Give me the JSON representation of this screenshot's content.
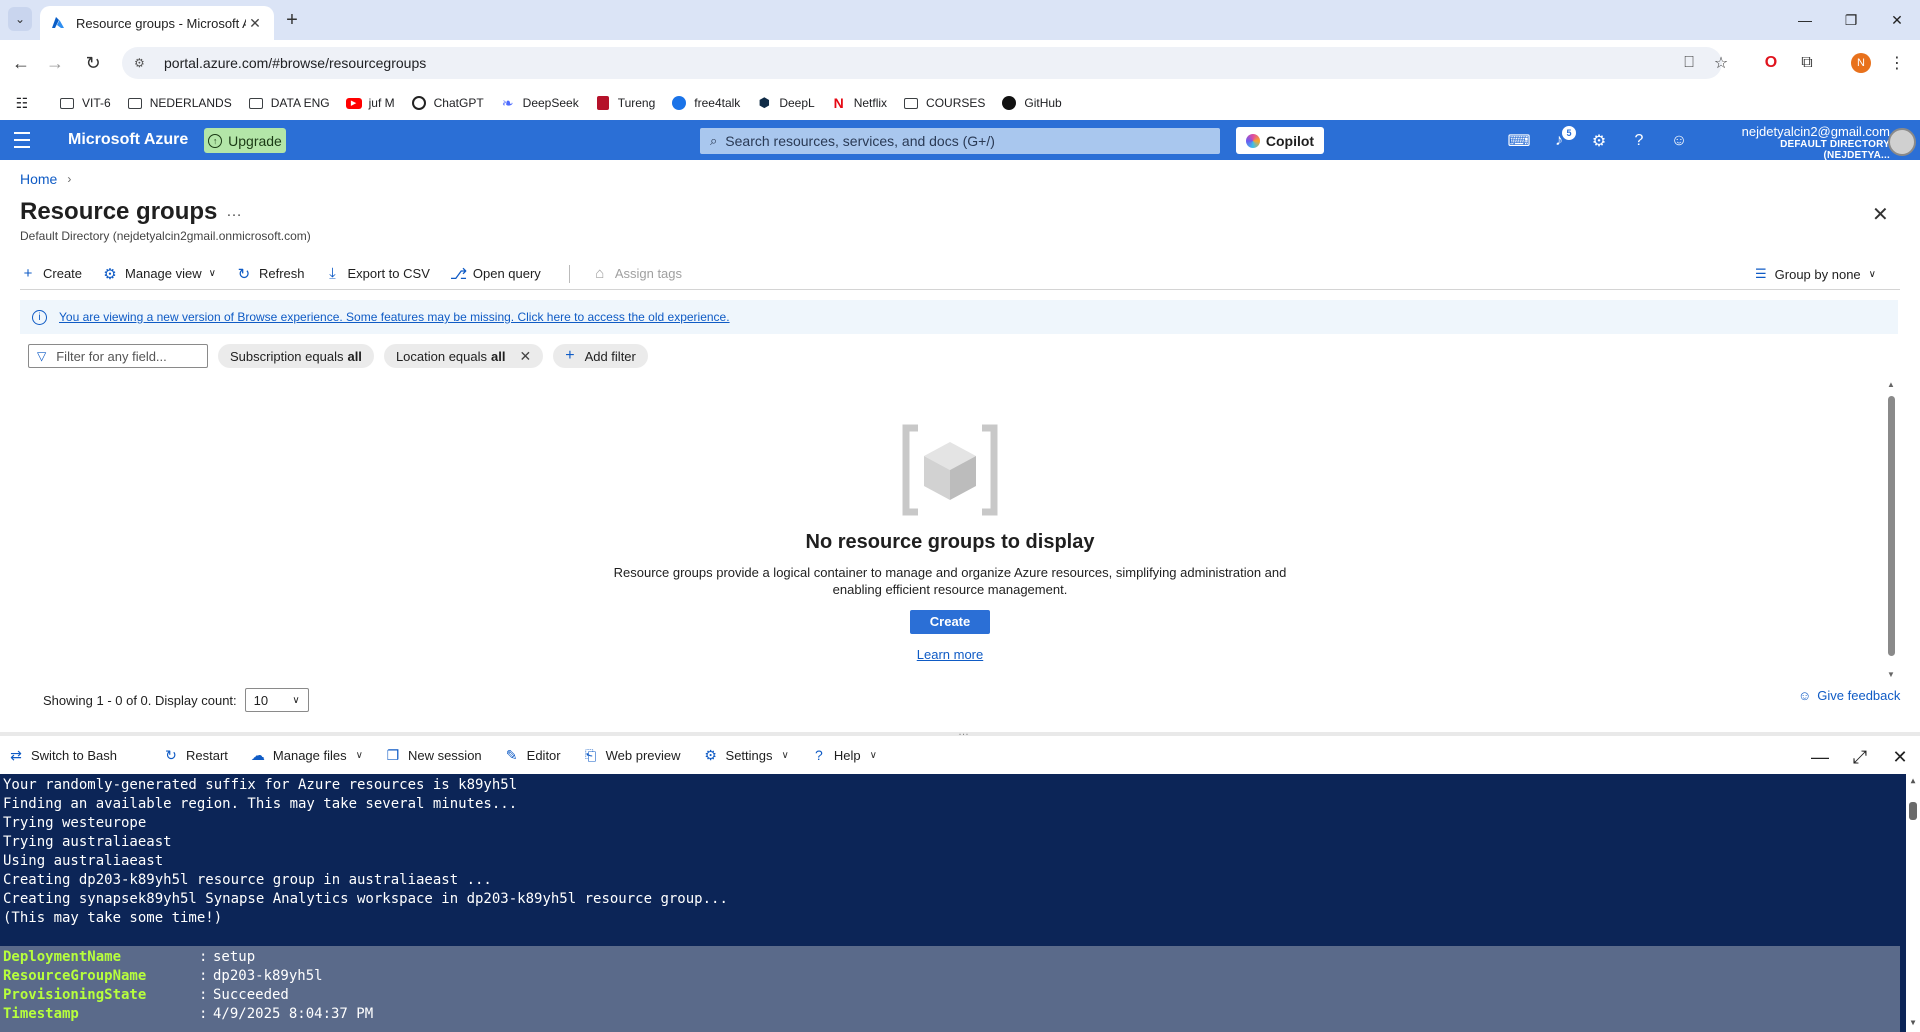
{
  "browser": {
    "tab_title": "Resource groups - Microsoft Azure",
    "url": "portal.azure.com/#browse/resourcegroups",
    "profile_initial": "N",
    "bookmarks": [
      {
        "label": "VIT-6",
        "icon": "folder"
      },
      {
        "label": "NEDERLANDS",
        "icon": "folder"
      },
      {
        "label": "DATA ENG",
        "icon": "folder"
      },
      {
        "label": "juf M",
        "icon": "youtube"
      },
      {
        "label": "ChatGPT",
        "icon": "chatgpt"
      },
      {
        "label": "DeepSeek",
        "icon": "deepseek"
      },
      {
        "label": "Tureng",
        "icon": "tureng"
      },
      {
        "label": "free4talk",
        "icon": "free4talk"
      },
      {
        "label": "DeepL",
        "icon": "deepl"
      },
      {
        "label": "Netflix",
        "icon": "netflix"
      },
      {
        "label": "COURSES",
        "icon": "folder"
      },
      {
        "label": "GitHub",
        "icon": "github"
      }
    ]
  },
  "azure_header": {
    "brand": "Microsoft Azure",
    "upgrade_label": "Upgrade",
    "search_placeholder": "Search resources, services, and docs (G+/)",
    "copilot_label": "Copilot",
    "notifications_count": "5",
    "user_email": "nejdetyalcin2@gmail.com",
    "user_directory": "DEFAULT DIRECTORY (NEJDETYA..."
  },
  "breadcrumb": {
    "home": "Home"
  },
  "page": {
    "title": "Resource groups",
    "subtitle": "Default Directory (nejdetyalcin2gmail.onmicrosoft.com)"
  },
  "commands": {
    "create": "Create",
    "manage_view": "Manage view",
    "refresh": "Refresh",
    "export_csv": "Export to CSV",
    "open_query": "Open query",
    "assign_tags": "Assign tags",
    "group_by": "Group by none"
  },
  "info_banner": "You are viewing a new version of Browse experience. Some features may be missing. Click here to access the old experience.",
  "filters": {
    "placeholder": "Filter for any field...",
    "subscription_prefix": "Subscription equals",
    "subscription_value": "all",
    "location_prefix": "Location equals",
    "location_value": "all",
    "add_filter": "Add filter"
  },
  "empty_state": {
    "title": "No resource groups to display",
    "description": "Resource groups provide a logical container to manage and organize Azure resources, simplifying administration and enabling efficient resource management.",
    "create_button": "Create",
    "learn_more": "Learn more"
  },
  "footer": {
    "showing": "Showing 1 - 0 of 0. Display count:",
    "display_count": "10",
    "feedback": "Give feedback"
  },
  "shell_toolbar": {
    "switch": "Switch to Bash",
    "restart": "Restart",
    "manage_files": "Manage files",
    "new_session": "New session",
    "editor": "Editor",
    "web_preview": "Web preview",
    "settings": "Settings",
    "help": "Help"
  },
  "terminal": {
    "lines": [
      "Your randomly-generated suffix for Azure resources is k89yh5l",
      "Finding an available region. This may take several minutes...",
      "Trying westeurope",
      "Trying australiaeast",
      "Using australiaeast",
      "Creating dp203-k89yh5l resource group in australiaeast ...",
      "Creating synapsek89yh5l Synapse Analytics workspace in dp203-k89yh5l resource group...",
      "(This may take some time!)"
    ],
    "table": [
      {
        "key": "DeploymentName",
        "value": "setup"
      },
      {
        "key": "ResourceGroupName",
        "value": "dp203-k89yh5l"
      },
      {
        "key": "ProvisioningState",
        "value": "Succeeded"
      },
      {
        "key": "Timestamp",
        "value": "4/9/2025 8:04:37 PM"
      }
    ]
  }
}
